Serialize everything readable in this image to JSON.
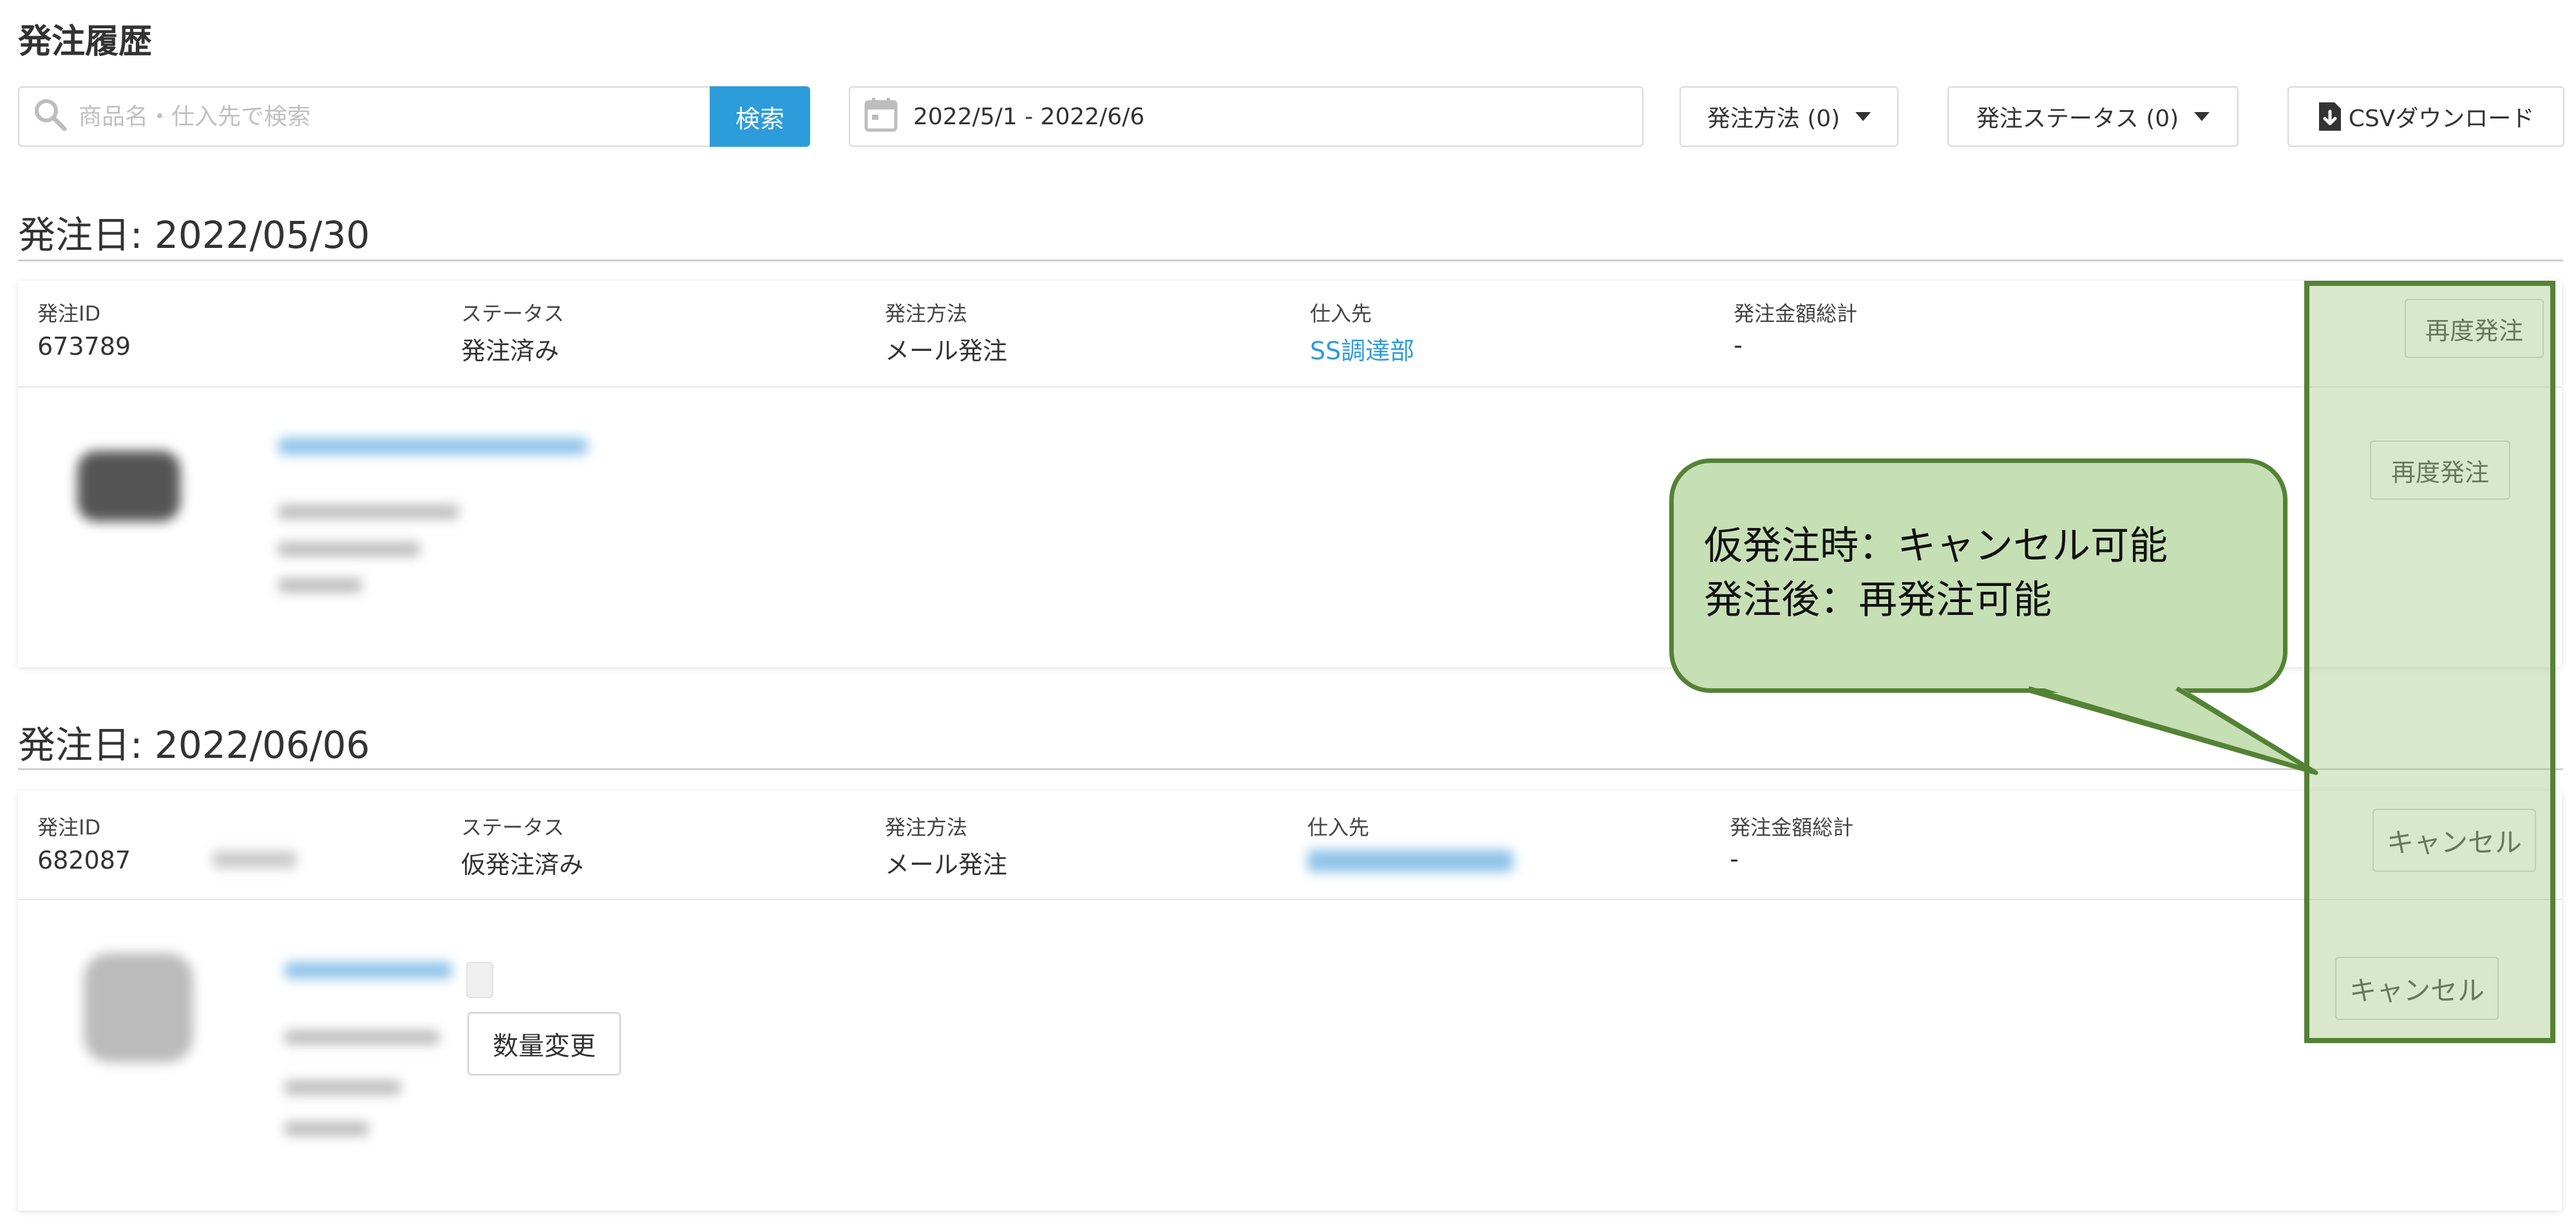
{
  "page_title": "発注履歴",
  "search": {
    "placeholder": "商品名・仕入先で検索",
    "button_label": "検索"
  },
  "date_range": "2022/5/1 - 2022/6/6",
  "filters": {
    "method_label": "発注方法 (0)",
    "status_label": "発注ステータス (0)"
  },
  "csv_button_label": "CSVダウンロード",
  "columns": {
    "order_id": "発注ID",
    "status": "ステータス",
    "method": "発注方法",
    "supplier": "仕入先",
    "total": "発注金額総計"
  },
  "orders": [
    {
      "date_heading": "発注日: 2022/05/30",
      "order_id": "673789",
      "status": "発注済み",
      "method": "メール発注",
      "supplier": "SS調達部",
      "total": "-",
      "header_button": "再度発注",
      "item_button": "再度発注"
    },
    {
      "date_heading": "発注日: 2022/06/06",
      "order_id": "682087",
      "status": "仮発注済み",
      "method": "メール発注",
      "supplier": "",
      "total": "-",
      "header_button": "キャンセル",
      "item_button": "キャンセル",
      "quantity_button": "数量変更"
    }
  ],
  "callout": {
    "line1": "仮発注時：キャンセル可能",
    "line2": "発注後：再発注可能"
  },
  "colors": {
    "accent_blue": "#2d9cdb",
    "highlight_border": "#548235",
    "callout_fill": "#c6dfb4"
  }
}
